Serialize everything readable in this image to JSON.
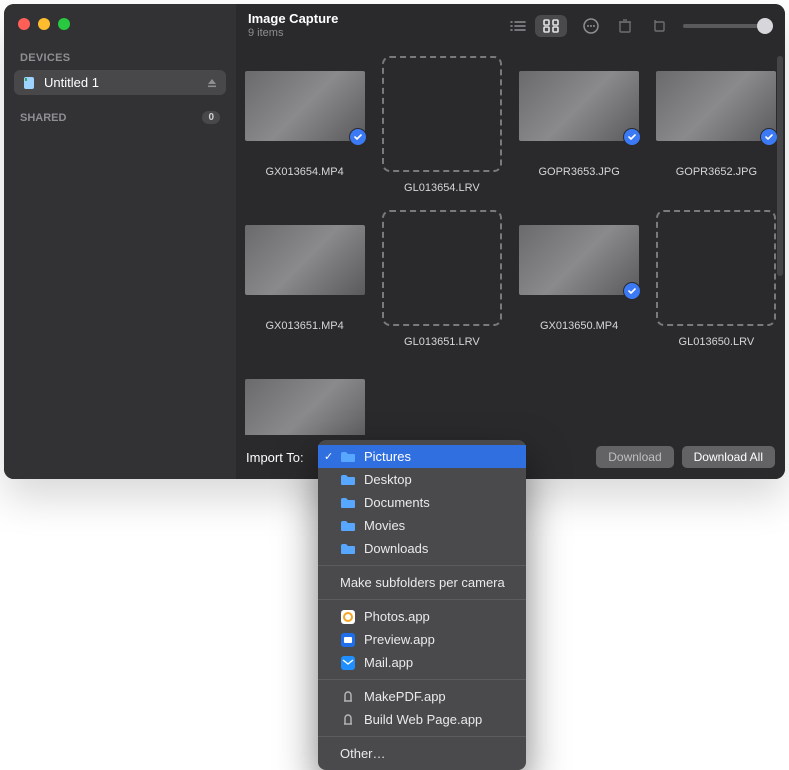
{
  "header": {
    "title": "Image Capture",
    "subtitle": "9 items"
  },
  "sidebar": {
    "devices_label": "DEVICES",
    "device_name": "Untitled 1",
    "shared_label": "SHARED",
    "shared_count": "0"
  },
  "items": [
    {
      "name": "GX013654.MP4",
      "type": "video",
      "imported": true,
      "placeholder": false
    },
    {
      "name": "GL013654.LRV",
      "type": "lrv",
      "imported": false,
      "placeholder": true
    },
    {
      "name": "GOPR3653.JPG",
      "type": "image",
      "imported": true,
      "placeholder": false
    },
    {
      "name": "GOPR3652.JPG",
      "type": "image",
      "imported": true,
      "placeholder": false
    },
    {
      "name": "GX013651.MP4",
      "type": "video",
      "imported": false,
      "placeholder": false
    },
    {
      "name": "GL013651.LRV",
      "type": "lrv",
      "imported": false,
      "placeholder": true
    },
    {
      "name": "GX013650.MP4",
      "type": "video",
      "imported": true,
      "placeholder": false
    },
    {
      "name": "GL013650.LRV",
      "type": "lrv",
      "imported": false,
      "placeholder": true
    },
    {
      "name": "",
      "type": "video",
      "imported": false,
      "placeholder": false
    }
  ],
  "footer": {
    "import_to_label": "Import To:",
    "download_label": "Download",
    "download_all_label": "Download All"
  },
  "menu": {
    "groups": [
      [
        {
          "label": "Pictures",
          "icon": "folder",
          "checked": true,
          "highlight": true
        },
        {
          "label": "Desktop",
          "icon": "folder",
          "checked": false,
          "highlight": false
        },
        {
          "label": "Documents",
          "icon": "folder",
          "checked": false,
          "highlight": false
        },
        {
          "label": "Movies",
          "icon": "folder",
          "checked": false,
          "highlight": false
        },
        {
          "label": "Downloads",
          "icon": "folder",
          "checked": false,
          "highlight": false
        }
      ],
      [
        {
          "label": "Make subfolders per camera",
          "icon": "",
          "checked": false,
          "highlight": false
        }
      ],
      [
        {
          "label": "Photos.app",
          "icon": "app-photos",
          "checked": false,
          "highlight": false
        },
        {
          "label": "Preview.app",
          "icon": "app-preview",
          "checked": false,
          "highlight": false
        },
        {
          "label": "Mail.app",
          "icon": "app-mail",
          "checked": false,
          "highlight": false
        }
      ],
      [
        {
          "label": "MakePDF.app",
          "icon": "automator",
          "checked": false,
          "highlight": false
        },
        {
          "label": "Build Web Page.app",
          "icon": "automator",
          "checked": false,
          "highlight": false
        }
      ],
      [
        {
          "label": "Other…",
          "icon": "",
          "checked": false,
          "highlight": false
        }
      ]
    ]
  },
  "icons": {
    "folder_color": "#57a6ff",
    "automator_color": "#b9b9bd"
  }
}
